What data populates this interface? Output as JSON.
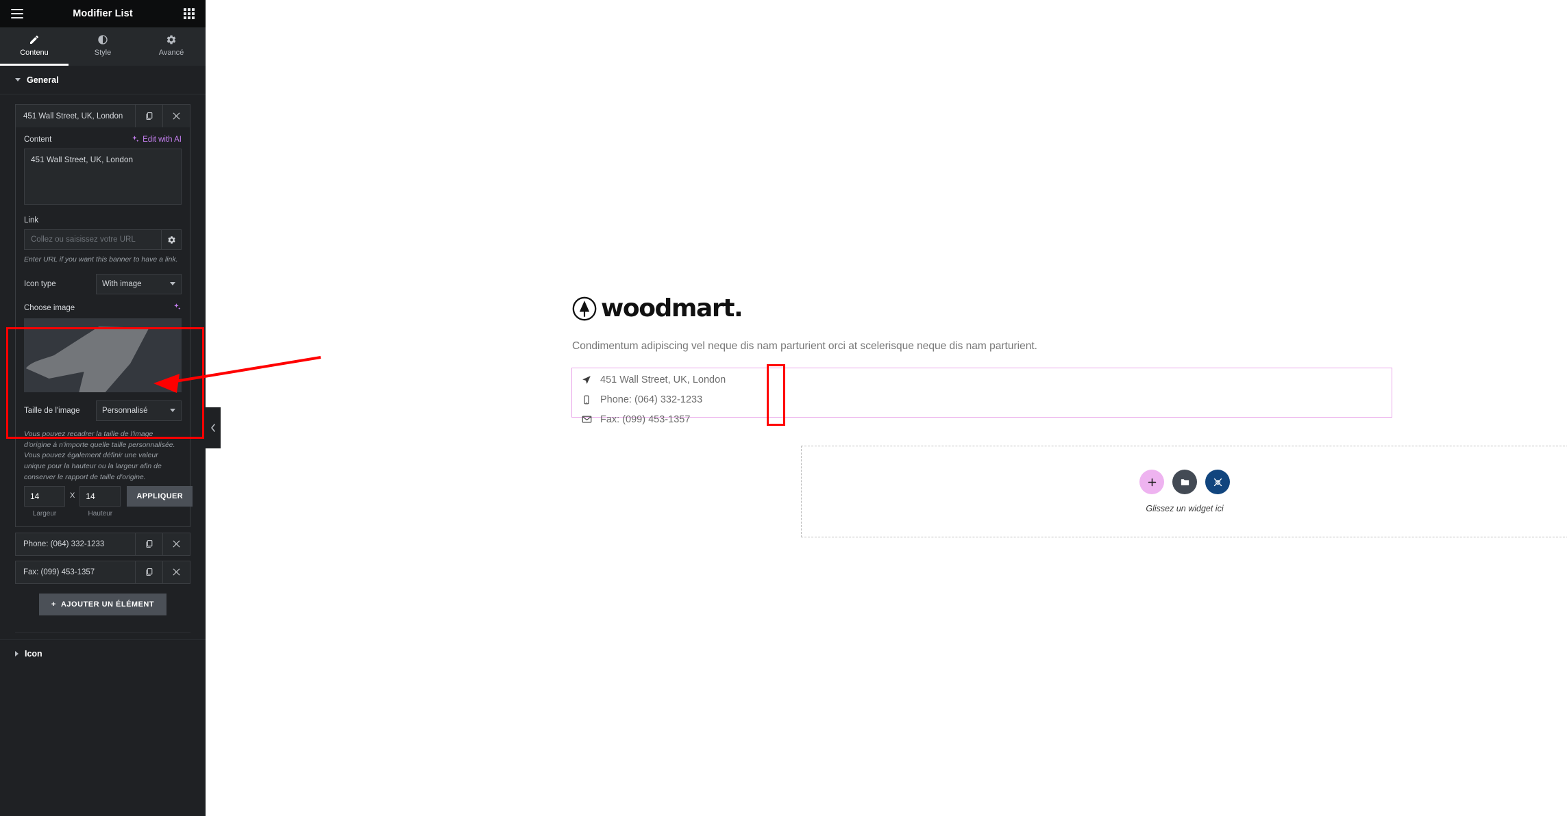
{
  "panel": {
    "title": "Modifier List",
    "menu_icon": "hamburger-icon",
    "apps_icon": "grid-apps-icon",
    "tabs": [
      {
        "label": "Contenu",
        "icon": "pencil-icon",
        "active": true
      },
      {
        "label": "Style",
        "icon": "contrast-circle-icon",
        "active": false
      },
      {
        "label": "Avancé",
        "icon": "gear-icon",
        "active": false
      }
    ],
    "sections": [
      {
        "label": "General",
        "expanded": true
      },
      {
        "label": "Icon",
        "expanded": false
      }
    ],
    "repeater": {
      "items": [
        {
          "label": "451 Wall Street, UK, London",
          "open": true
        },
        {
          "label": "Phone: (064) 332-1233",
          "open": false
        },
        {
          "label": "Fax: (099) 453-1357",
          "open": false
        }
      ],
      "duplicate_icon": "copy-icon",
      "remove_icon": "close-icon",
      "add_item_label": "AJOUTER UN ÉLÉMENT",
      "add_item_icon": "plus-icon"
    },
    "item_form": {
      "content_label": "Content",
      "edit_with_ai_label": "Edit with AI",
      "edit_with_ai_icon": "sparkle-icon",
      "content_value": "451 Wall Street, UK, London",
      "link_label": "Link",
      "link_value": "",
      "link_placeholder": "Collez ou saisissez votre URL",
      "link_settings_icon": "gear-icon",
      "link_hint": "Enter URL if you want this banner to have a link.",
      "icon_type_label": "Icon type",
      "icon_type_value": "With image",
      "choose_image_label": "Choose image",
      "choose_image_ai_icon": "sparkle-icon",
      "image_size_label": "Taille de l'image",
      "image_size_value": "Personnalisé",
      "image_size_hint": "Vous pouvez recadrer la taille de l'image d'origine à n'importe quelle taille personnalisée. Vous pouvez également définir une valeur unique pour la hauteur ou la largeur afin de conserver le rapport de taille d'origine.",
      "width_value": "14",
      "width_sub_label": "Largeur",
      "height_value": "14",
      "height_sub_label": "Hauteur",
      "dimension_separator": "X",
      "apply_label": "APPLIQUER"
    },
    "collapse_icon": "chevron-left-icon"
  },
  "canvas": {
    "logo_text": "woodmart.",
    "logo_mark_icon": "tree-in-circle-icon",
    "tagline": "Condimentum adipiscing vel neque dis nam parturient orci at scelerisque neque dis nam parturient.",
    "contact_items": [
      {
        "icon": "location-arrow-icon",
        "text": "451 Wall Street, UK, London"
      },
      {
        "icon": "mobile-phone-icon",
        "text": "Phone: (064) 332-1233"
      },
      {
        "icon": "envelope-icon",
        "text": "Fax: (099) 453-1357"
      }
    ],
    "dropzone": {
      "label": "Glissez un widget ici",
      "buttons": [
        {
          "icon": "plus-icon",
          "color": "#eeb3f0",
          "name": "add-widget-button"
        },
        {
          "icon": "folder-icon",
          "color": "#434a54",
          "name": "templates-button"
        },
        {
          "icon": "ai-builder-icon",
          "color": "#11457e",
          "name": "ai-builder-button"
        }
      ]
    }
  },
  "annotations": {
    "highlight_color": "#ff0000",
    "arrow_color": "#ff0000",
    "highlight_target": "choose-image-control",
    "icon_highlight_target": "contact-icons-column"
  },
  "colors": {
    "panel_bg": "#1f2124",
    "panel_header_bg": "#0c0d0e",
    "tabs_bg": "#26292c",
    "accent_ai": "#c57ff0",
    "selection_outline": "#e9a6e9",
    "canvas_bg": "#ffffff"
  }
}
